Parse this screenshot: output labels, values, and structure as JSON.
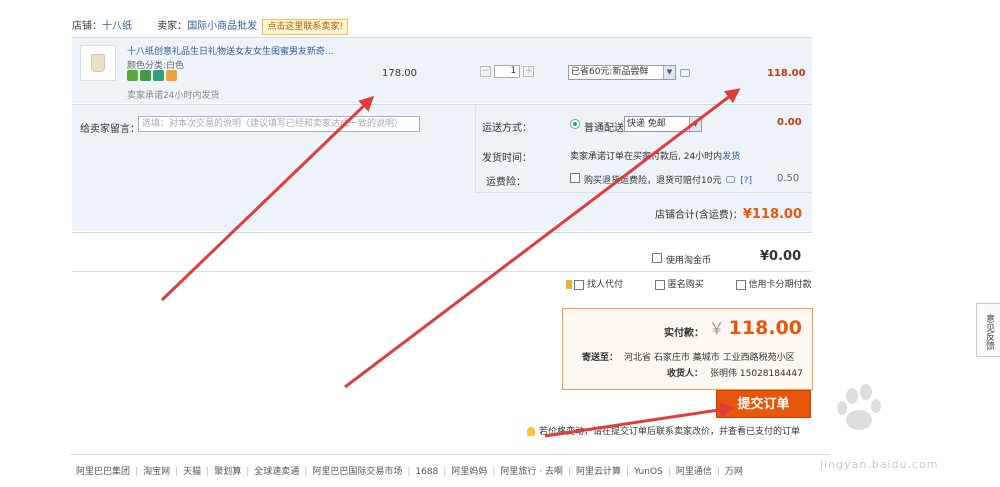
{
  "shop": {
    "shop_label": "店铺：",
    "shop_name": "十八纸",
    "seller_label": "卖家：",
    "seller_name": "国际小商品批发",
    "contact_button": "点击这里联系卖家!"
  },
  "item": {
    "title": "十八纸创意礼品生日礼物送女友女生闺蜜男友新奇...",
    "color": "颜色分类:白色",
    "shipping_promise": "卖家承诺24小时内发货",
    "unit_price": "178.00",
    "quantity": "1",
    "minus": "−",
    "plus": "+",
    "promotion": "已省60元:新品尝鲜",
    "total": "118.00",
    "badge_colors": [
      "#5aa83b",
      "#3c9e3f",
      "#2f9f7d",
      "#e9a33a"
    ]
  },
  "options": {
    "message_label": "给卖家留言：",
    "message_placeholder": "选填：对本次交易的说明（建议填写已经和卖家达成一致的说明）",
    "shipping_label": "运送方式：",
    "shipping_normal": "普通配送",
    "shipping_select": "快递 免邮",
    "shipping_fee": "0.00",
    "delivery_time_label": "发货时间：",
    "delivery_time_value": "卖家承诺订单在买家付款后, 24小时内",
    "delivery_time_link": "发货",
    "insurance_label": "运费险：",
    "insurance_text": "购买退货运费险，退货可赔付10元",
    "insurance_help": "[?]",
    "insurance_fee": "0.50",
    "shop_total_label": "店铺合计(含运费)：",
    "shop_total_value": "¥118.00"
  },
  "coins": {
    "label": "使用淘金币",
    "amount": "¥0.00"
  },
  "extras": {
    "proxy_pay": "找人代付",
    "anonymous": "匿名购买",
    "installment": "信用卡分期付款"
  },
  "summary": {
    "pay_label": "实付款：",
    "yen": "￥",
    "pay_amount": "118.00",
    "address_label": "寄送至：",
    "address_value": "河北省 石家庄市 藁城市 工业西路税苑小区",
    "receiver_label": "收货人：",
    "receiver_value": "张明伟 15028184447"
  },
  "submit_label": "提交订单",
  "notice": "若价格变动，请在提交订单后联系卖家改价，并查看已支付的订单",
  "footer": [
    "阿里巴巴集团",
    "淘宝网",
    "天猫",
    "聚划算",
    "全球速卖通",
    "阿里巴巴国际交易市场",
    "1688",
    "阿里妈妈",
    "阿里旅行 · 去啊",
    "阿里云计算",
    "YunOS",
    "阿里通信",
    "万网"
  ],
  "feedback_tab": "意见反馈",
  "watermark": {
    "logo": "Baidu经验",
    "url": "jingyan.baidu.com"
  },
  "colors": {
    "accent_orange": "#e8560b",
    "link_blue": "#2f5b9a",
    "arrow_red": "#e03c3c",
    "panel_bg": "#eef3fa"
  }
}
